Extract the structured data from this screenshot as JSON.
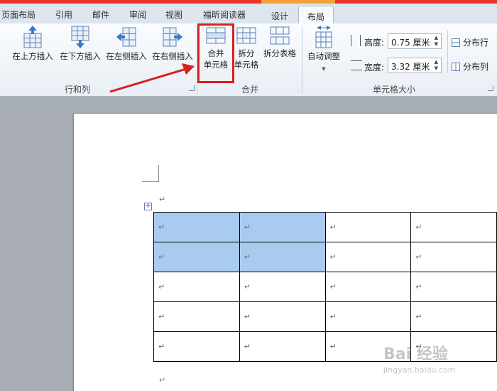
{
  "tabs": [
    "页面布局",
    "引用",
    "邮件",
    "审阅",
    "视图",
    "福昕阅读器",
    "设计",
    "布局"
  ],
  "active_tab": "布局",
  "groups": {
    "rows_cols": {
      "label": "行和列",
      "buttons": [
        "在上方插入",
        "在下方插入",
        "在左侧插入",
        "在右侧插入"
      ]
    },
    "merge": {
      "label": "合并",
      "merge_cells": [
        "合并",
        "单元格"
      ],
      "split_cells": [
        "拆分",
        "单元格"
      ],
      "split_table": "拆分表格"
    },
    "cell_size": {
      "label": "单元格大小",
      "autofit": "自动调整",
      "height_label": "高度:",
      "height_value": "0.75 厘米",
      "width_label": "宽度:",
      "width_value": "3.32 厘米",
      "distribute_rows": "分布行",
      "distribute_cols": "分布列"
    }
  },
  "document": {
    "para_mark": "↵",
    "table": {
      "rows": 5,
      "cols": 4,
      "cell_mark": "↵",
      "selected": [
        [
          0,
          0
        ],
        [
          0,
          1
        ],
        [
          1,
          0
        ],
        [
          1,
          1
        ]
      ]
    }
  },
  "watermark": {
    "brand": "Bai 经验",
    "url": "jingyan.baidu.com"
  },
  "colors": {
    "highlight_box": "#d9201e",
    "selection": "#a8cbee",
    "arrow": "#d9201e"
  }
}
